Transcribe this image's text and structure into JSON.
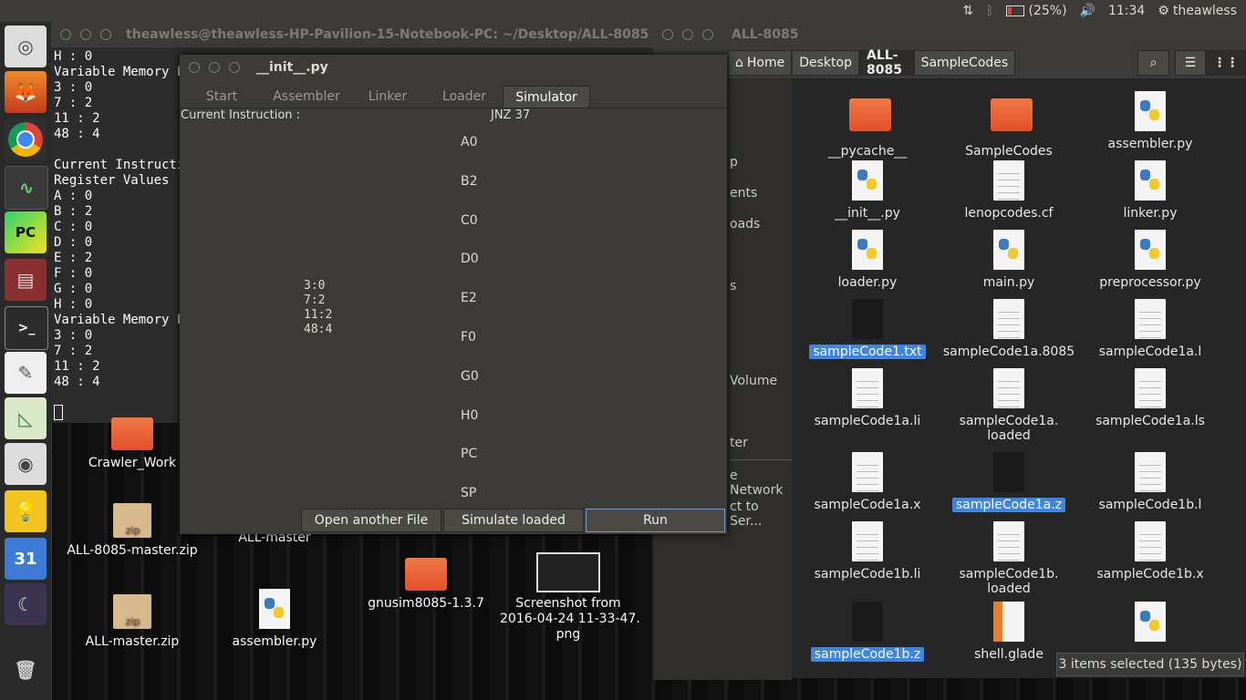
{
  "top_panel": {
    "battery": "(25%)",
    "time": "11:34",
    "user": "theawless"
  },
  "terminal": {
    "title": "theawless@theawless-HP-Pavilion-15-Notebook-PC: ~/Desktop/ALL-8085",
    "lines": [
      "H : 0",
      "Variable Memory L",
      "3 : 0",
      "7 : 2",
      "11 : 2",
      "48 : 4",
      "",
      "Current Instructio",
      "Register Values",
      "A : 0",
      "B : 2",
      "C : 0",
      "D : 0",
      "E : 2",
      "F : 0",
      "G : 0",
      "H : 0",
      "Variable Memory L",
      "3 : 0",
      "7 : 2",
      "11 : 2",
      "48 : 4"
    ]
  },
  "app": {
    "title": "__init__.py",
    "tabs": [
      "Start",
      "Assembler",
      "Linker",
      "Loader",
      "Simulator"
    ],
    "current_label": "Current Instruction :",
    "current_value": "JNZ 37",
    "memory": [
      "3:0",
      "7:2",
      "11:2",
      "48:4"
    ],
    "registers": [
      "A0",
      "B2",
      "C0",
      "D0",
      "E2",
      "F0",
      "G0",
      "H0",
      "PC",
      "SP"
    ],
    "buttons": {
      "open": "Open another File",
      "simulate": "Simulate loaded",
      "run": "Run"
    }
  },
  "file_manager": {
    "title": "ALL-8085",
    "crumbs": [
      "Home",
      "Desktop",
      "ALL-8085",
      "SampleCodes"
    ],
    "sidebar": [
      "p",
      "ents",
      "oads",
      "s",
      "Volume",
      "ter",
      "e Network",
      "ct to Ser..."
    ],
    "files": [
      {
        "name": "__pycache__",
        "type": "folder"
      },
      {
        "name": "SampleCodes",
        "type": "folder"
      },
      {
        "name": "assembler.py",
        "type": "py"
      },
      {
        "name": "__init__.py",
        "type": "py"
      },
      {
        "name": "lenopcodes.cf",
        "type": "doc"
      },
      {
        "name": "linker.py",
        "type": "py"
      },
      {
        "name": "loader.py",
        "type": "py"
      },
      {
        "name": "main.py",
        "type": "py"
      },
      {
        "name": "preprocessor.py",
        "type": "py"
      },
      {
        "name": "sampleCode1.txt",
        "type": "dark",
        "selected": true
      },
      {
        "name": "sampleCode1a.8085",
        "type": "doc"
      },
      {
        "name": "sampleCode1a.l",
        "type": "doc"
      },
      {
        "name": "sampleCode1a.li",
        "type": "doc"
      },
      {
        "name": "sampleCode1a.\nloaded",
        "type": "doc"
      },
      {
        "name": "sampleCode1a.ls",
        "type": "doc"
      },
      {
        "name": "sampleCode1a.x",
        "type": "doc"
      },
      {
        "name": "sampleCode1a.z",
        "type": "dark",
        "selected": true
      },
      {
        "name": "sampleCode1b.l",
        "type": "doc"
      },
      {
        "name": "sampleCode1b.li",
        "type": "doc"
      },
      {
        "name": "sampleCode1b.\nloaded",
        "type": "doc"
      },
      {
        "name": "sampleCode1b.x",
        "type": "doc"
      },
      {
        "name": "sampleCode1b.z",
        "type": "dark",
        "selected": true
      },
      {
        "name": "shell.glade",
        "type": "glade"
      },
      {
        "name": "",
        "type": "py"
      }
    ],
    "status": "3 items selected  (135 bytes)"
  },
  "desktop": [
    {
      "name": "Crawler_Work",
      "type": "folder"
    },
    {
      "name": "ALL-8085-master.zip",
      "type": "zip"
    },
    {
      "name": "ALL-master",
      "type": "none"
    },
    {
      "name": "gnusim8085-1.3.7",
      "type": "folder"
    },
    {
      "name": "Screenshot from\n2016-04-24 11-33-47.\npng",
      "type": "shot"
    },
    {
      "name": "ALL-master.zip",
      "type": "zip"
    },
    {
      "name": "assembler.py",
      "type": "py"
    }
  ],
  "launcher": [
    "ubuntu-icon",
    "firefox-icon",
    "chrome-icon",
    "system-monitor-icon",
    "pycharm-icon",
    "files-icon",
    "terminal-icon",
    "text-editor-icon",
    "geogebra-icon",
    "speaker-icon",
    "idea-icon",
    "calendar-icon",
    "app-icon",
    "trash-icon"
  ],
  "calendar_day": "31"
}
